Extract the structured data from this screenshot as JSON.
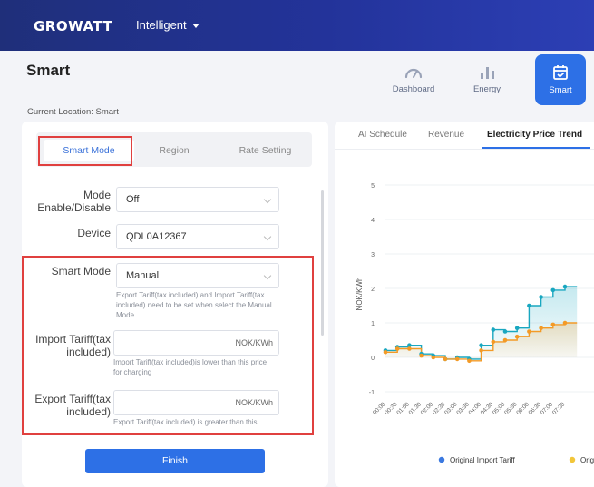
{
  "header": {
    "logo_text": "GROWATT",
    "mode_label": "Intelligent"
  },
  "page": {
    "title": "Smart",
    "breadcrumb": "Current Location: Smart"
  },
  "nav": [
    {
      "label": "Dashboard",
      "icon": "gauge-icon"
    },
    {
      "label": "Energy",
      "icon": "bar-chart-icon"
    },
    {
      "label": "Smart",
      "icon": "calendar-check-icon",
      "active": true
    }
  ],
  "left": {
    "tabs": [
      "Smart Mode",
      "Region",
      "Rate Setting"
    ],
    "active_tab": "Smart Mode",
    "mode_label": "Mode Enable/Disable",
    "mode_value": "Off",
    "device_label": "Device",
    "device_value": "QDL0A12367",
    "smart_mode_label": "Smart Mode",
    "smart_mode_value": "Manual",
    "smart_mode_hint": "Export Tariff(tax included) and Import Tariff(tax included) need to be set when select the Manual Mode",
    "import_label": "Import Tariff(tax included)",
    "import_unit": "NOK/KWh",
    "import_value": "",
    "import_hint": "Import Tariff(tax included)is lower than this price for charging",
    "export_label": "Export Tariff(tax included)",
    "export_unit": "NOK/KWh",
    "export_value": "",
    "export_hint": "Export Tariff(tax included) is greater than this",
    "finish_label": "Finish"
  },
  "right": {
    "tabs": [
      "AI Schedule",
      "Revenue",
      "Electricity Price Trend"
    ],
    "active_tab": "Electricity Price Trend"
  },
  "chart_data": {
    "type": "line",
    "ylabel": "NOK/KWh",
    "ylim": [
      -1,
      5
    ],
    "yticks": [
      "-1",
      "0",
      "1",
      "2",
      "3",
      "4",
      "5"
    ],
    "x": [
      "00:00",
      "00:30",
      "01:00",
      "01:30",
      "02:00",
      "02:30",
      "03:00",
      "03:30",
      "04:00",
      "04:30",
      "05:00",
      "05:30",
      "06:00",
      "06:30",
      "07:00",
      "07:30"
    ],
    "series": [
      {
        "name": "Original Import Tariff",
        "color": "#19a7c0",
        "values": [
          0.2,
          0.3,
          0.35,
          0.1,
          0.05,
          -0.05,
          0.0,
          -0.05,
          0.35,
          0.8,
          0.75,
          0.85,
          1.5,
          1.75,
          1.95,
          2.05
        ]
      },
      {
        "name": "Original Export Tariff",
        "color": "#f39a26",
        "values": [
          0.15,
          0.25,
          0.25,
          0.05,
          0.0,
          -0.05,
          -0.05,
          -0.1,
          0.2,
          0.45,
          0.5,
          0.6,
          0.75,
          0.85,
          0.95,
          1.0
        ]
      }
    ],
    "legend_position": "bottom",
    "legend_dot_colors": [
      "#3b79e0",
      "#f2c63a"
    ],
    "grid": true
  }
}
